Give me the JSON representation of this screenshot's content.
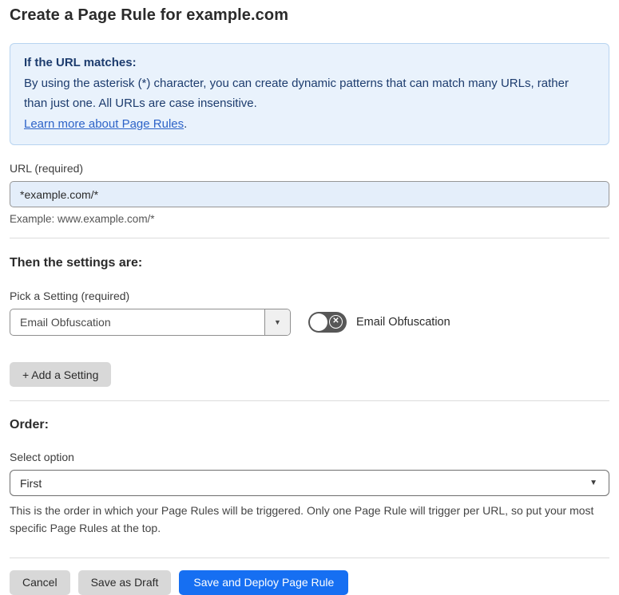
{
  "page": {
    "title": "Create a Page Rule for example.com"
  },
  "info_box": {
    "heading": "If the URL matches:",
    "body": "By using the asterisk (*) character, you can create dynamic patterns that can match many URLs, rather than just one. All URLs are case insensitive.",
    "link_label": "Learn more about Page Rules",
    "link_suffix": "."
  },
  "url_field": {
    "label": "URL (required)",
    "value": "*example.com/*",
    "hint": "Example: www.example.com/*"
  },
  "settings_section": {
    "heading": "Then the settings are:",
    "picker_label": "Pick a Setting (required)",
    "picker_value": "Email Obfuscation",
    "picker_arrow": "▼",
    "toggle_state": "off",
    "toggle_x_glyph": "✕",
    "toggle_label": "Email Obfuscation",
    "add_setting_label": "+ Add a Setting"
  },
  "order_section": {
    "heading": "Order:",
    "select_label": "Select option",
    "select_value": "First",
    "select_arrow": "▼",
    "help_text": "This is the order in which your Page Rules will be triggered. Only one Page Rule will trigger per URL, so put your most specific Page Rules at the top."
  },
  "footer": {
    "cancel_label": "Cancel",
    "save_draft_label": "Save as Draft",
    "save_deploy_label": "Save and Deploy Page Rule"
  },
  "colors": {
    "primary_blue": "#166ff2",
    "info_bg": "#e9f2fc",
    "info_border": "#b8d4f0",
    "info_text": "#1d3c6e",
    "link_blue": "#2d63c8",
    "input_bg": "#e4eefa",
    "button_gray": "#d8d8d8",
    "toggle_off_bg": "#575757"
  }
}
